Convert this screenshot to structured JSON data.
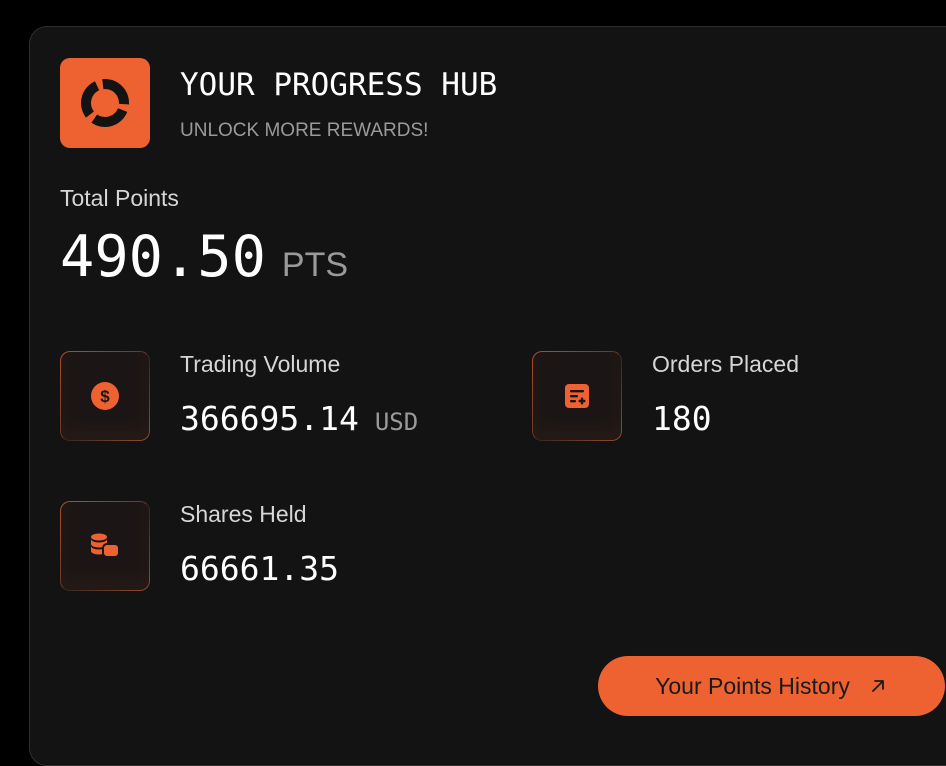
{
  "header": {
    "title": "YOUR PROGRESS HUB",
    "subtitle": "UNLOCK MORE REWARDS!",
    "logo_icon": "progress-ring-icon"
  },
  "total_points": {
    "label": "Total Points",
    "value": "490.50",
    "unit": "PTS"
  },
  "stats": {
    "trading_volume": {
      "label": "Trading Volume",
      "value": "366695.14",
      "unit": "USD",
      "icon": "dollar-coin-icon"
    },
    "orders_placed": {
      "label": "Orders Placed",
      "value": "180",
      "icon": "order-list-add-icon"
    },
    "shares_held": {
      "label": "Shares Held",
      "value": "66661.35",
      "icon": "coin-stack-icon"
    }
  },
  "actions": {
    "history_label": "Your Points History",
    "history_icon": "arrow-up-right-icon"
  },
  "colors": {
    "accent": "#ee6231",
    "background": "#000000",
    "card": "#131313",
    "muted_text": "#9a9a9a"
  }
}
